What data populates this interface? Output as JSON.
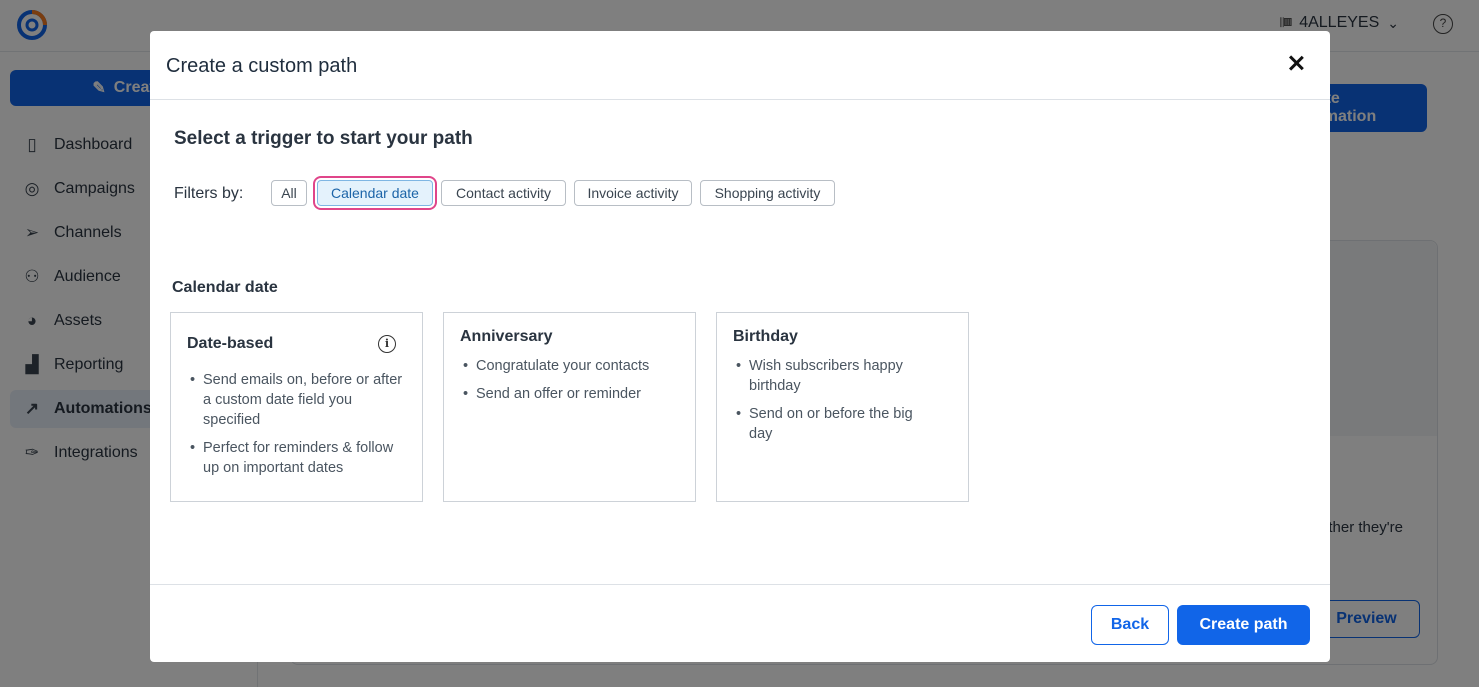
{
  "app": {
    "account_name": "4ALLEYES",
    "create_label": "Create",
    "primary_action_label": "Create automation",
    "nav": [
      {
        "label": "Dashboard",
        "icon": "dashboard-icon"
      },
      {
        "label": "Campaigns",
        "icon": "campaigns-icon"
      },
      {
        "label": "Channels",
        "icon": "channels-icon"
      },
      {
        "label": "Audience",
        "icon": "audience-icon"
      },
      {
        "label": "Assets",
        "icon": "assets-icon"
      },
      {
        "label": "Reporting",
        "icon": "reporting-icon"
      },
      {
        "label": "Automations",
        "icon": "automations-icon",
        "active": true
      },
      {
        "label": "Integrations",
        "icon": "integrations-icon"
      }
    ],
    "bg_snippet": "ether they're",
    "bg_preview_label": "Preview"
  },
  "modal": {
    "title": "Create a custom path",
    "heading": "Select a trigger to start your path",
    "filters_label": "Filters by:",
    "filters": [
      "All",
      "Calendar date",
      "Contact activity",
      "Invoice activity",
      "Shopping activity"
    ],
    "selected_filter": "Calendar date",
    "group_label": "Calendar date",
    "cards": [
      {
        "title": "Date-based",
        "has_info": true,
        "bullets": [
          "Send emails on, before or after a custom date field you specified",
          "Perfect for reminders & follow up on important dates"
        ]
      },
      {
        "title": "Anniversary",
        "bullets": [
          "Congratulate your contacts",
          "Send an offer or reminder"
        ]
      },
      {
        "title": "Birthday",
        "bullets": [
          "Wish subscribers happy birthday",
          "Send on or before the big day"
        ]
      }
    ],
    "back_label": "Back",
    "create_path_label": "Create path"
  },
  "colors": {
    "accent": "#1165e8",
    "selected_chip_outline": "#e0458a"
  }
}
